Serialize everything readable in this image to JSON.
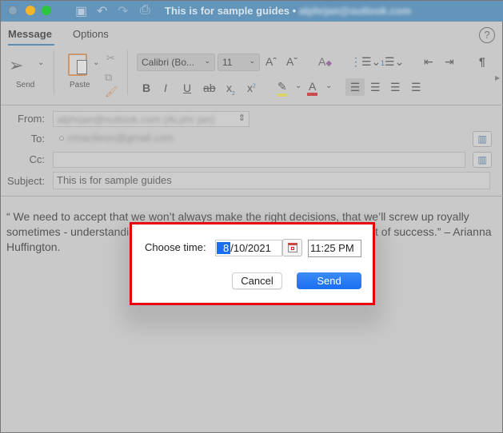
{
  "window": {
    "title": "This is for sample guides •",
    "account": "alphrjan@outlook.com"
  },
  "tabs": [
    {
      "label": "Message",
      "active": true
    },
    {
      "label": "Options",
      "active": false
    }
  ],
  "ribbon": {
    "send_label": "Send",
    "paste_label": "Paste",
    "font_name": "Calibri (Bo...",
    "font_size": "11"
  },
  "header": {
    "from_label": "From:",
    "from_value": "alphrjan@outlook.com (ALphr jan)",
    "to_label": "To:",
    "to_value": "cmacibron@gmail.com",
    "cc_label": "Cc:",
    "cc_value": "",
    "subject_label": "Subject:",
    "subject_value": "This is for sample guides"
  },
  "body": {
    "line1": "“ We need to accept that we won’t always make the right decisions, that we’ll screw up royally",
    "line2_start": "sometimes - understandin",
    "line2_end": "t of success.” – Arianna",
    "line3": "Huffington."
  },
  "dialog": {
    "label": "Choose time:",
    "date_month": "8",
    "date_rest": "/10/2021",
    "time": "11:25 PM",
    "cancel": "Cancel",
    "send": "Send",
    "accent": "#1a6ff0",
    "highlight_border": "#e8000b"
  }
}
